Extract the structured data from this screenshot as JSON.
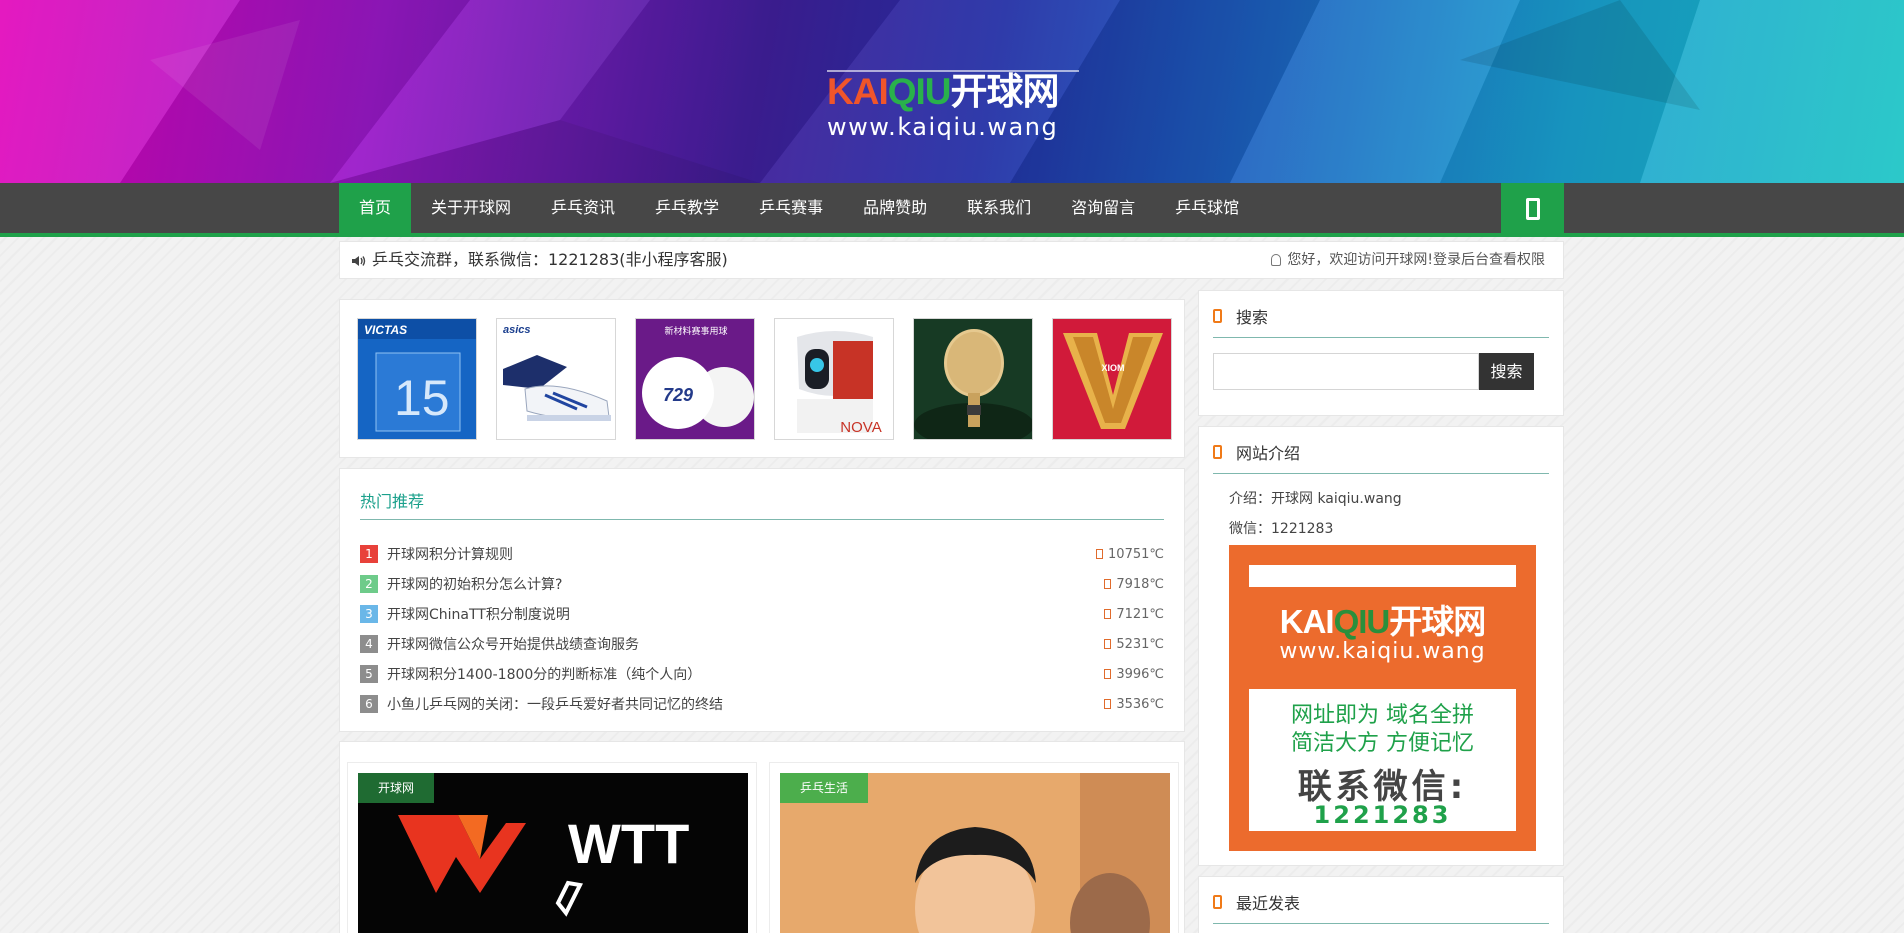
{
  "header": {
    "logo_part1": "KAI",
    "logo_part2": "QIU",
    "logo_part3": "开球网",
    "logo_url": "www.kaiqiu.wang"
  },
  "nav": {
    "items": [
      "首页",
      "关于开球网",
      "乒乓资讯",
      "乒乓教学",
      "乒乓赛事",
      "品牌赞助",
      "联系我们",
      "咨询留言",
      "乒乓球馆"
    ],
    "active_index": 0,
    "mobile_icon": "mobile-icon"
  },
  "notice": {
    "left_text": "乒乓交流群，联系微信：1221283(非小程序客服)",
    "right_text": "您好，欢迎访问开球网!登录后台查看权限"
  },
  "products": [
    {
      "name": "victas-rubber",
      "label": "VICTAS",
      "big": "15"
    },
    {
      "name": "asics-shoes",
      "label": "asics"
    },
    {
      "name": "729-balls",
      "label": "新材料赛事用球",
      "big": "729"
    },
    {
      "name": "nova-robot",
      "label": "NOVA"
    },
    {
      "name": "blade",
      "label": ""
    },
    {
      "name": "xiom-rubber",
      "label": "XIOM"
    }
  ],
  "hot": {
    "title": "热门推荐",
    "items": [
      {
        "rank": "1",
        "title": "开球网积分计算规则",
        "views": "10751℃",
        "color": "#e8413a"
      },
      {
        "rank": "2",
        "title": "开球网的初始积分怎么计算?",
        "views": "7918℃",
        "color": "#6ecb8a"
      },
      {
        "rank": "3",
        "title": "开球网ChinaTT积分制度说明",
        "views": "7121℃",
        "color": "#6ab7e8"
      },
      {
        "rank": "4",
        "title": "开球网微信公众号开始提供战绩查询服务",
        "views": "5231℃",
        "color": "#8d8d8d"
      },
      {
        "rank": "5",
        "title": "开球网积分1400-1800分的判断标准（纯个人向）",
        "views": "3996℃",
        "color": "#8d8d8d"
      },
      {
        "rank": "6",
        "title": "小鱼儿乒乓网的关闭：一段乒乓爱好者共同记忆的终结",
        "views": "3536℃",
        "color": "#8d8d8d"
      }
    ]
  },
  "posts": [
    {
      "category": "开球网",
      "cat_color": "#1f6b32",
      "image_text": "WTT"
    },
    {
      "category": "乒乓生活",
      "cat_color": "#4cae4c"
    }
  ],
  "sidebar": {
    "search_title": "搜索",
    "search_placeholder": "",
    "search_button": "搜索",
    "intro_title": "网站介绍",
    "intro_line1": "介绍：开球网 kaiqiu.wang",
    "intro_line2": "微信：1221283",
    "promo_logo1": "KAI",
    "promo_logo2": "QIU",
    "promo_logo3": "开球网",
    "promo_url": "www.kaiqiu.wang",
    "promo_line3": "网址即为 域名全拼",
    "promo_line4": "简洁大方 方便记忆",
    "promo_line5": "联系微信:",
    "promo_line6": "1221283",
    "recent_title": "最近发表"
  },
  "colors": {
    "accent_green": "#1fa14a",
    "nav_bg": "#474747",
    "promo_orange": "#ec6b2d"
  }
}
